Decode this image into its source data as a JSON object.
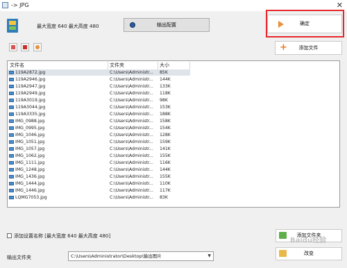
{
  "window": {
    "title": "-> JPG",
    "close_glyph": "✕"
  },
  "header": {
    "max_info": "最大宽度 640 最大高度 480",
    "output_config_label": "输出配置"
  },
  "buttons": {
    "confirm": "确定",
    "add_file": "添加文件",
    "add_folder": "添加文件夹",
    "change": "改变"
  },
  "toolbar": {
    "icons": [
      "remove-file-icon",
      "clear-list-icon",
      "settings-icon"
    ]
  },
  "list": {
    "headers": {
      "name": "文件名",
      "folder": "文件夹",
      "size": "大小"
    },
    "rows": [
      {
        "name": "119A2872.jpg",
        "folder": "C:\\Users\\Administr...",
        "size": "85K"
      },
      {
        "name": "119A2946.jpg",
        "folder": "C:\\Users\\Administr...",
        "size": "144K"
      },
      {
        "name": "119A2947.jpg",
        "folder": "C:\\Users\\Administr...",
        "size": "133K"
      },
      {
        "name": "119A2949.jpg",
        "folder": "C:\\Users\\Administr...",
        "size": "118K"
      },
      {
        "name": "119A3019.jpg",
        "folder": "C:\\Users\\Administr...",
        "size": "98K"
      },
      {
        "name": "119A3044.jpg",
        "folder": "C:\\Users\\Administr...",
        "size": "153K"
      },
      {
        "name": "119A3335.jpg",
        "folder": "C:\\Users\\Administr...",
        "size": "188K"
      },
      {
        "name": "IMG_0988.jpg",
        "folder": "C:\\Users\\Administr...",
        "size": "158K"
      },
      {
        "name": "IMG_0995.jpg",
        "folder": "C:\\Users\\Administr...",
        "size": "154K"
      },
      {
        "name": "IMG_1046.jpg",
        "folder": "C:\\Users\\Administr...",
        "size": "128K"
      },
      {
        "name": "IMG_1051.jpg",
        "folder": "C:\\Users\\Administr...",
        "size": "159K"
      },
      {
        "name": "IMG_1057.jpg",
        "folder": "C:\\Users\\Administr...",
        "size": "141K"
      },
      {
        "name": "IMG_1062.jpg",
        "folder": "C:\\Users\\Administr...",
        "size": "155K"
      },
      {
        "name": "IMG_1111.jpg",
        "folder": "C:\\Users\\Administr...",
        "size": "116K"
      },
      {
        "name": "IMG_1248.jpg",
        "folder": "C:\\Users\\Administr...",
        "size": "144K"
      },
      {
        "name": "IMG_1436.jpg",
        "folder": "C:\\Users\\Administr...",
        "size": "155K"
      },
      {
        "name": "IMG_1444.jpg",
        "folder": "C:\\Users\\Administr...",
        "size": "110K"
      },
      {
        "name": "IMG_1446.jpg",
        "folder": "C:\\Users\\Administr...",
        "size": "117K"
      },
      {
        "name": "LQMG7053.jpg",
        "folder": "C:\\Users\\Administr...",
        "size": "83K"
      }
    ]
  },
  "options": {
    "add_setting_name": "添加设置名称 [最大宽度 640 最大高度 480]"
  },
  "output": {
    "label": "输出文件夹",
    "path": "C:\\Users\\Administrator\\Desktop\\输出图片"
  },
  "watermark": "Baidu经验",
  "colors": {
    "highlight": "#e8262b",
    "accent_orange": "#e87a1e",
    "selected_row": "#dfe4ea"
  }
}
